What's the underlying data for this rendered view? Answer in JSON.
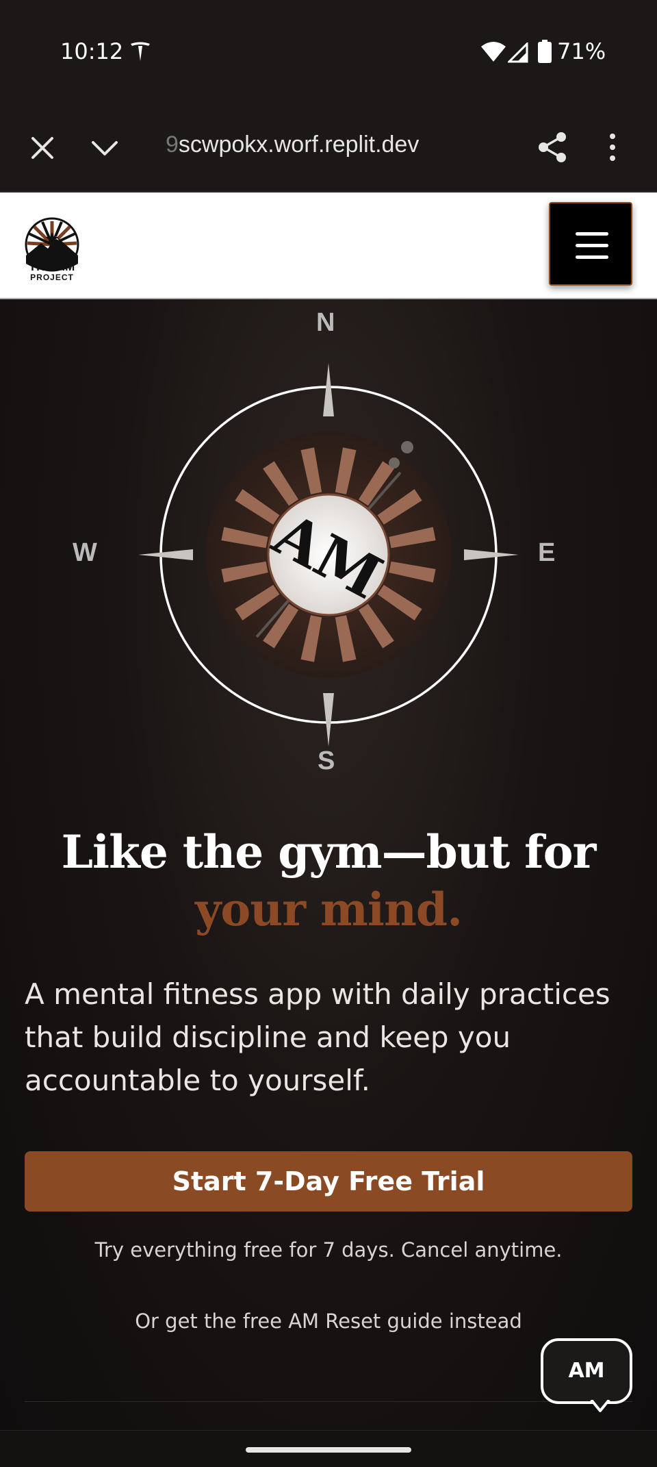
{
  "status_bar": {
    "time": "10:12",
    "battery": "71%"
  },
  "browser": {
    "url_faded": "9",
    "url": "scwpokx.worf.replit.dev"
  },
  "site": {
    "logo_line1": "THE AM",
    "logo_line2": "PROJECT"
  },
  "compass": {
    "north": "N",
    "south": "S",
    "east": "E",
    "west": "W",
    "center_text": "AM"
  },
  "hero": {
    "headline_line1": "Like the gym—but for",
    "headline_accent": "your mind.",
    "subtext": "A mental fitness app with daily practices that build discipline and keep you accountable to yourself.",
    "cta_label": "Start 7-Day Free Trial",
    "trial_note": "Try everything free for 7 days. Cancel anytime.",
    "guide_link": "Or get the free AM Reset guide instead"
  },
  "chat": {
    "label": "AM"
  },
  "colors": {
    "accent": "#8a4a24",
    "background": "#141111",
    "header_bg": "#ffffff"
  }
}
